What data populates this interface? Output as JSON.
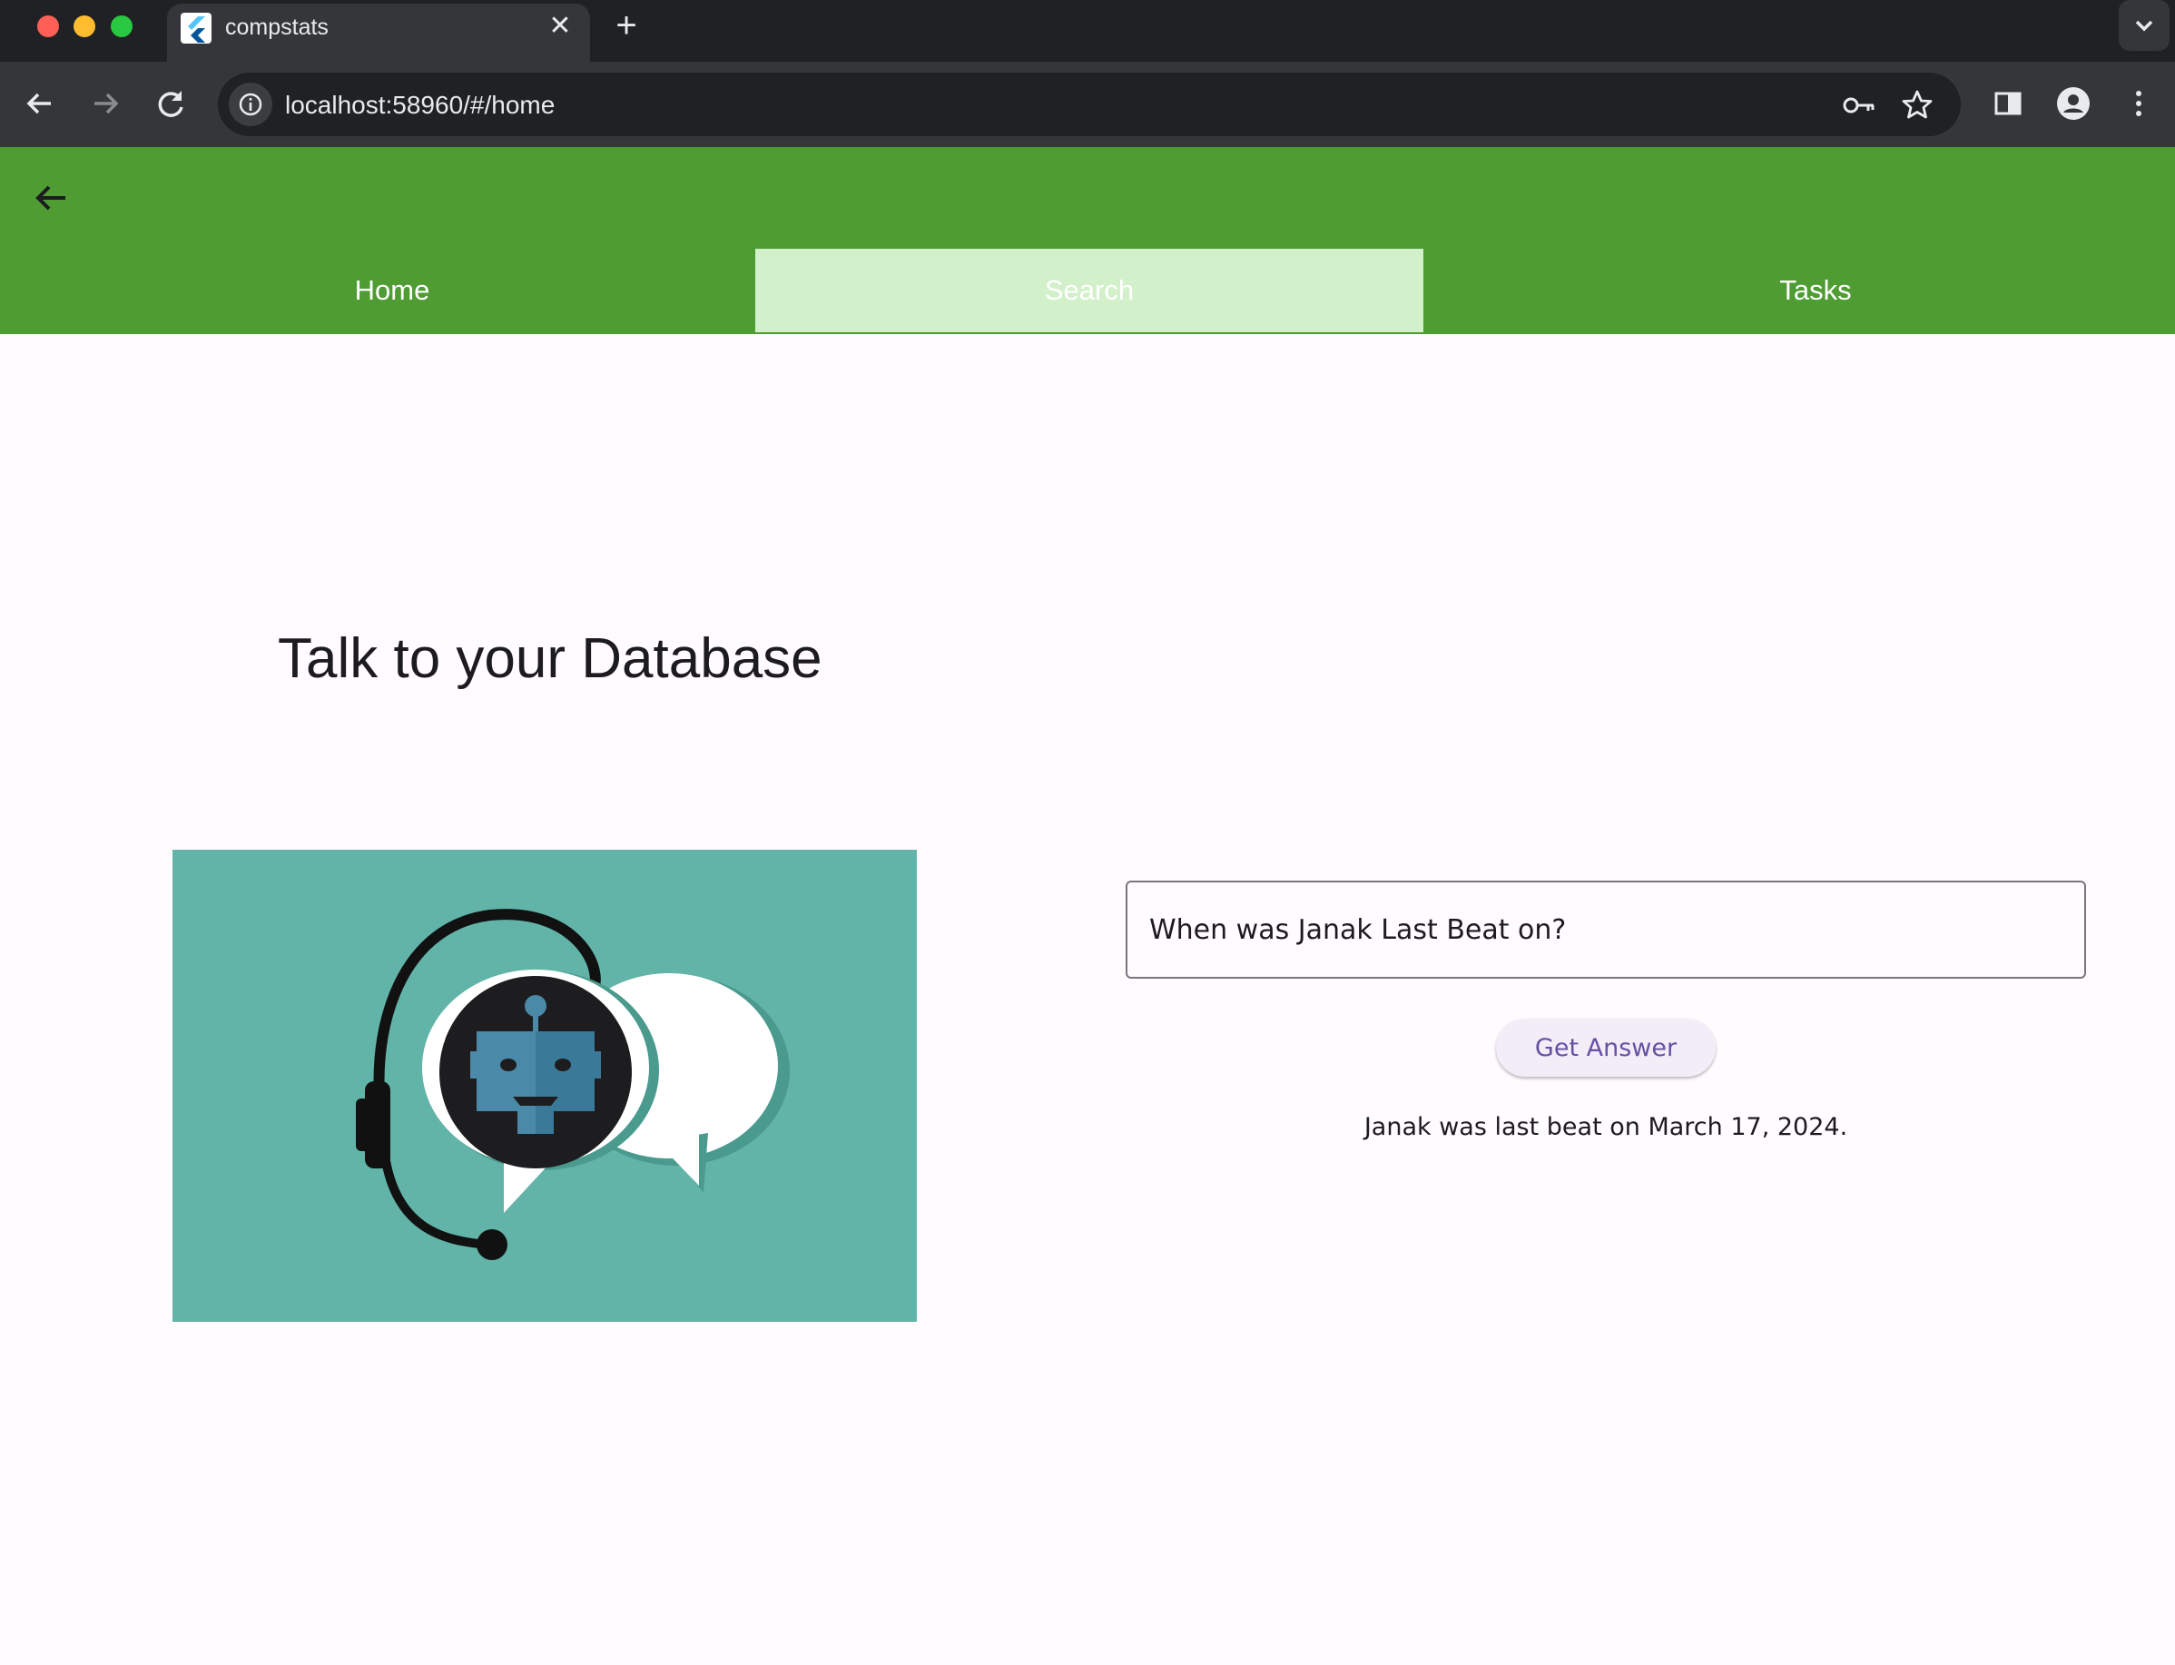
{
  "browser": {
    "tab_title": "compstats",
    "url": "localhost:58960/#/home"
  },
  "nav": {
    "tabs": [
      {
        "label": "Home",
        "selected": false
      },
      {
        "label": "Search",
        "selected": true
      },
      {
        "label": "Tasks",
        "selected": false
      }
    ]
  },
  "main": {
    "heading": "Talk to your Database",
    "query_value": "When was Janak Last Beat on?",
    "button_label": "Get Answer",
    "answer": "Janak was last beat on March 17, 2024."
  },
  "colors": {
    "appbar": "#4e9c32",
    "selected_tab": "#d2f1ca",
    "illustration_bg": "#62b4a9",
    "button_text": "#6750a4"
  },
  "icons": [
    "back-arrow-icon",
    "forward-arrow-icon",
    "reload-icon",
    "site-info-icon",
    "key-icon",
    "star-icon",
    "side-panel-icon",
    "profile-icon",
    "more-vert-icon",
    "close-icon",
    "new-tab-icon",
    "chevron-down-icon",
    "flutter-icon",
    "robot-support-illustration"
  ]
}
